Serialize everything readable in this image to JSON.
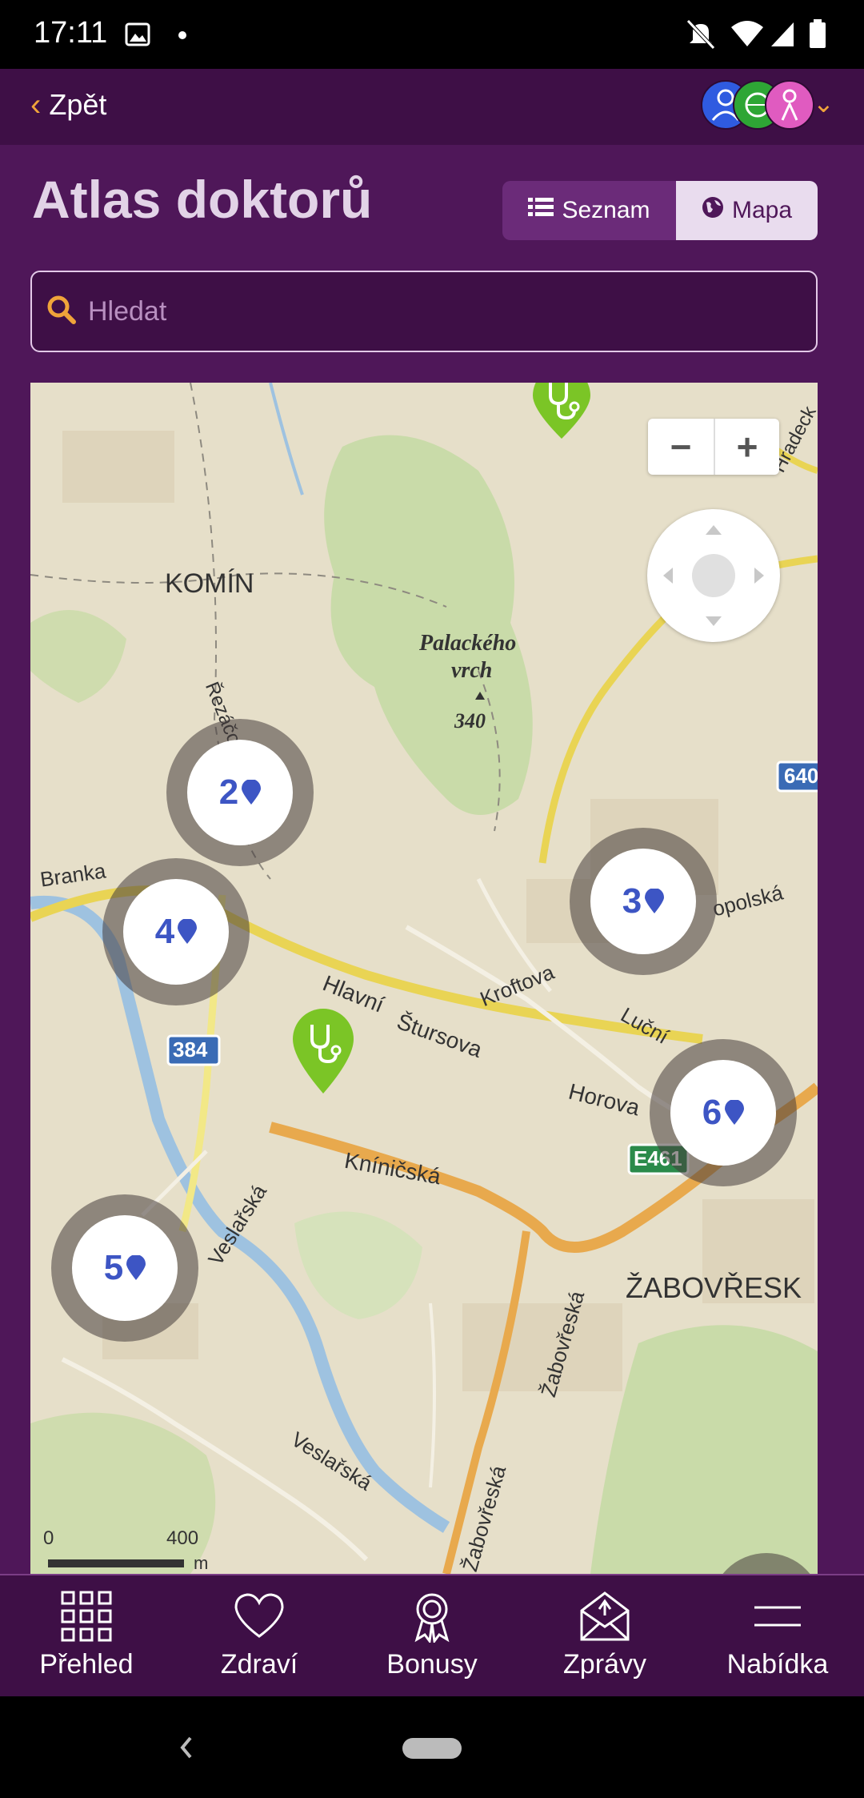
{
  "status_bar": {
    "time": "17:11"
  },
  "header": {
    "back_label": "Zpět"
  },
  "page": {
    "title": "Atlas doktorů"
  },
  "view_toggle": {
    "list_label": "Seznam",
    "map_label": "Mapa",
    "active": "Mapa"
  },
  "search": {
    "placeholder": "Hledat",
    "value": ""
  },
  "map": {
    "zoom_out": "−",
    "zoom_in": "+",
    "clusters": [
      {
        "count": "2"
      },
      {
        "count": "4"
      },
      {
        "count": "3"
      },
      {
        "count": "6"
      },
      {
        "count": "5"
      }
    ],
    "labels": {
      "komin": "KOMÍN",
      "palackeho": "Palackého",
      "vrch": "vrch",
      "elev": "340",
      "rezacova": "Řezáčova",
      "branka": "Branka",
      "hlavni": "Hlavní",
      "sturssova": "Štursova",
      "kroftova": "Kroftova",
      "lucni": "Luční",
      "horova": "Horova",
      "kninicska": "Kníničská",
      "veslarska1": "Veslařská",
      "veslarska2": "Veslařská",
      "zabovreska1": "Žabovřeská",
      "zabovreska2": "Žabovřeská",
      "zabovresky": "ŽABOVŘESK",
      "opolska": "opolská",
      "hradecka": "Hradeck",
      "road384": "384",
      "road640": "640",
      "roadE461": "E461",
      "scale_zero": "0",
      "scale_400": "400",
      "scale_unit": "m"
    }
  },
  "bottom_nav": [
    {
      "label": "Přehled",
      "icon": "grid-icon"
    },
    {
      "label": "Zdraví",
      "icon": "heart-icon"
    },
    {
      "label": "Bonusy",
      "icon": "medal-icon"
    },
    {
      "label": "Zprávy",
      "icon": "envelope-icon"
    },
    {
      "label": "Nabídka",
      "icon": "menu-icon"
    }
  ],
  "colors": {
    "primary": "#4f1759",
    "header": "#3e0f46",
    "accent": "#f0a43a",
    "cluster_text": "#3d55c4",
    "doctor_pin": "#7bc526"
  }
}
